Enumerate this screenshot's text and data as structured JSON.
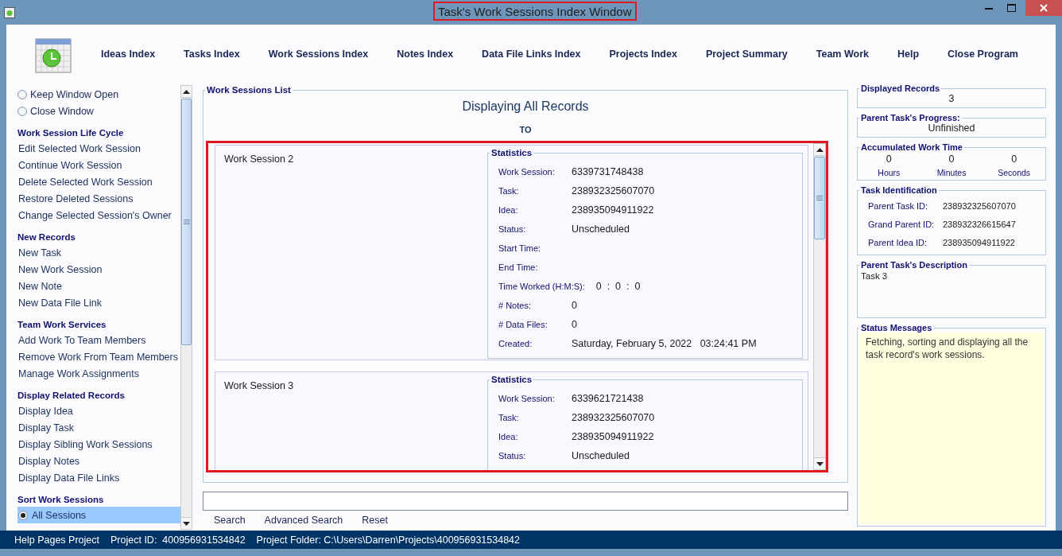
{
  "window": {
    "title": "Task's Work Sessions Index Window"
  },
  "nav": [
    {
      "label": "Ideas Index"
    },
    {
      "label": "Tasks Index"
    },
    {
      "label": "Work Sessions Index"
    },
    {
      "label": "Notes Index"
    },
    {
      "label": "Data File Links Index"
    },
    {
      "label": "Projects Index"
    },
    {
      "label": "Project Summary"
    },
    {
      "label": "Team Work"
    },
    {
      "label": "Help"
    },
    {
      "label": "Close Program"
    }
  ],
  "window_options": [
    {
      "label": "Keep Window Open",
      "selected": false
    },
    {
      "label": "Close Window",
      "selected": false
    }
  ],
  "sidebar": {
    "sections": [
      {
        "title": "Work Session Life Cycle",
        "items": [
          {
            "label": "Edit Selected Work Session"
          },
          {
            "label": "Continue Work Session"
          },
          {
            "label": "Delete Selected Work Session"
          },
          {
            "label": "Restore Deleted Sessions"
          },
          {
            "label": "Change Selected Session's Owner"
          }
        ]
      },
      {
        "title": "New Records",
        "items": [
          {
            "label": "New Task"
          },
          {
            "label": "New Work Session"
          },
          {
            "label": "New Note"
          },
          {
            "label": "New Data File Link"
          }
        ]
      },
      {
        "title": "Team Work Services",
        "items": [
          {
            "label": "Add Work To Team Members"
          },
          {
            "label": "Remove Work From Team Members"
          },
          {
            "label": "Manage Work Assignments"
          }
        ]
      },
      {
        "title": "Display Related Records",
        "items": [
          {
            "label": "Display Idea"
          },
          {
            "label": "Display Task"
          },
          {
            "label": "Display Sibling Work Sessions"
          },
          {
            "label": "Display Notes"
          },
          {
            "label": "Display Data File Links"
          }
        ]
      },
      {
        "title": "Sort Work Sessions",
        "items": [
          {
            "label": "All Sessions",
            "kind": "radio",
            "selected": true
          }
        ]
      }
    ]
  },
  "work_sessions_list": {
    "title": "Work Sessions List",
    "heading": "Displaying All Records",
    "subheading": "TO",
    "sessions": [
      {
        "name": "Work Session 2",
        "statistics_title": "Statistics",
        "stats": [
          {
            "label": "Work Session:",
            "value": "6339731748438"
          },
          {
            "label": "Task:",
            "value": "238932325607070"
          },
          {
            "label": "Idea:",
            "value": "238935094911922"
          },
          {
            "label": "Status:",
            "value": "Unscheduled"
          },
          {
            "label": "Start Time:"
          },
          {
            "label": "End Time:"
          },
          {
            "label": "Time Worked (H:M:S):",
            "value": "0  :  0  :  0"
          },
          {
            "label": "# Notes:",
            "value": "0"
          },
          {
            "label": "# Data Files:",
            "value": "0"
          },
          {
            "label": "Created:",
            "value": "Saturday, February 5, 2022   03:24:41 PM"
          }
        ]
      },
      {
        "name": "Work Session 3",
        "statistics_title": "Statistics",
        "stats": [
          {
            "label": "Work Session:",
            "value": "6339621721438"
          },
          {
            "label": "Task:",
            "value": "238932325607070"
          },
          {
            "label": "Idea:",
            "value": "238935094911922"
          },
          {
            "label": "Status:",
            "value": "Unscheduled"
          }
        ]
      }
    ]
  },
  "search": {
    "links": [
      {
        "label": "Search"
      },
      {
        "label": "Advanced Search"
      },
      {
        "label": "Reset"
      }
    ]
  },
  "right_panel": {
    "displayed_records": {
      "title": "Displayed Records",
      "value": "3"
    },
    "progress": {
      "title": "Parent Task's Progress:",
      "value": "Unfinished"
    },
    "work_time": {
      "title": "Accumulated Work Time",
      "parts": [
        {
          "value": "0",
          "unit": "Hours"
        },
        {
          "value": "0",
          "unit": "Minutes"
        },
        {
          "value": "0",
          "unit": "Seconds"
        }
      ]
    },
    "identification": {
      "title": "Task Identification",
      "rows": [
        {
          "label": "Parent Task ID:",
          "value": "238932325607070"
        },
        {
          "label": "Grand Parent ID:",
          "value": "238932326615647"
        },
        {
          "label": "Parent Idea ID:",
          "value": "238935094911922"
        }
      ]
    },
    "description": {
      "title": "Parent Task's Description",
      "text": "Task 3"
    },
    "status_messages": {
      "title": "Status Messages",
      "text": "Fetching, sorting and displaying all the task record's work sessions."
    }
  },
  "status_bar": [
    "Help Pages Project",
    "Project ID:  400956931534842",
    "Project Folder: C:\\Users\\Darren\\Projects\\400956931534842"
  ]
}
